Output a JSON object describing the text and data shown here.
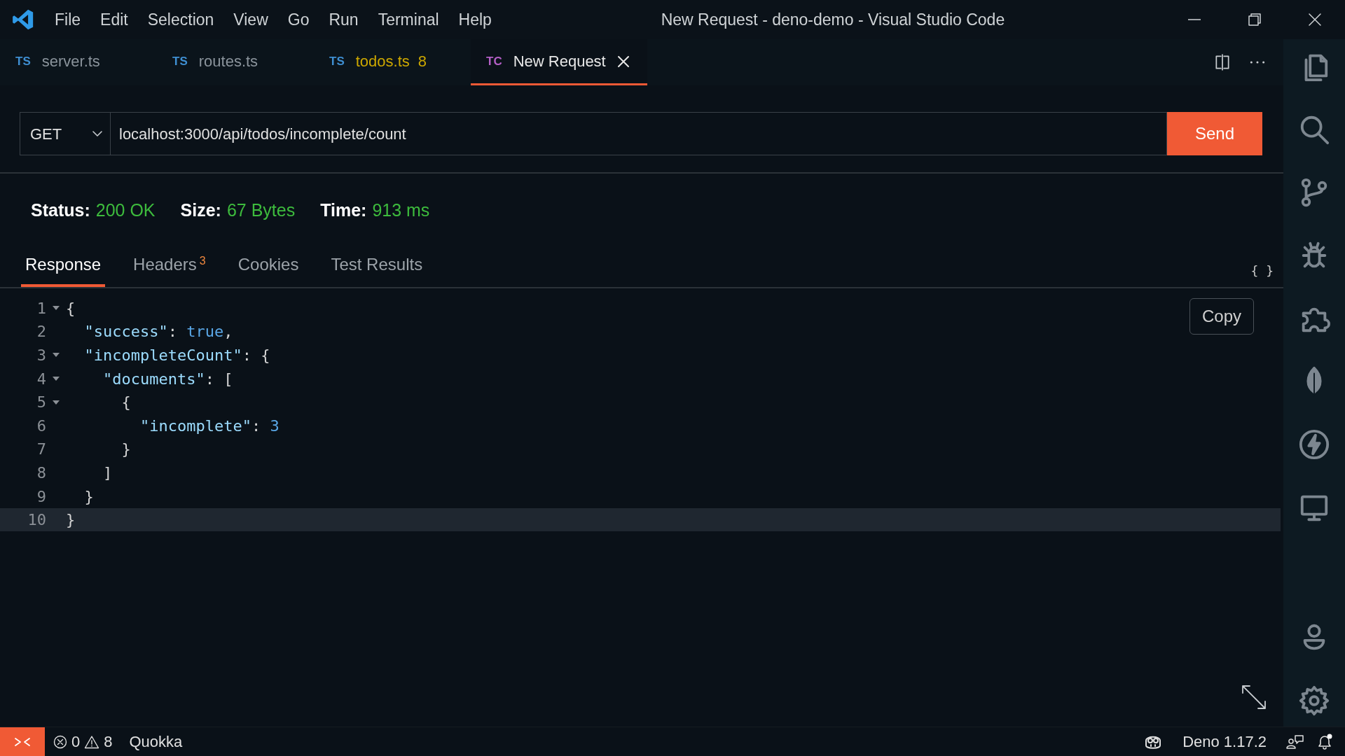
{
  "window": {
    "title": "New Request - deno-demo - Visual Studio Code"
  },
  "menu": [
    "File",
    "Edit",
    "Selection",
    "View",
    "Go",
    "Run",
    "Terminal",
    "Help"
  ],
  "editor_tabs": [
    {
      "badge": "TS",
      "color": "#3f8fd2",
      "label": "server.ts",
      "selected": false,
      "warning": false
    },
    {
      "badge": "TS",
      "color": "#3f8fd2",
      "label": "routes.ts",
      "selected": false,
      "warning": false
    },
    {
      "badge": "TS",
      "color": "#3f8fd2",
      "label": "todos.ts",
      "problems": "8",
      "selected": false,
      "warning": true
    },
    {
      "badge": "TC",
      "color": "#b45fc6",
      "label": "New Request",
      "selected": true,
      "warning": false
    }
  ],
  "request": {
    "method": "GET",
    "url": "localhost:3000/api/todos/incomplete/count",
    "send": "Send"
  },
  "response_info": [
    {
      "label": "Status:",
      "value": "200 OK"
    },
    {
      "label": "Size:",
      "value": "67 Bytes"
    },
    {
      "label": "Time:",
      "value": "913 ms"
    }
  ],
  "response_tabs": [
    {
      "label": "Response",
      "selected": true
    },
    {
      "label": "Headers",
      "badge": "3",
      "selected": false
    },
    {
      "label": "Cookies",
      "selected": false
    },
    {
      "label": "Test Results",
      "selected": false
    }
  ],
  "format_button": "{ }",
  "copy_button": "Copy",
  "code": {
    "lines": [
      {
        "number": "1",
        "foldable": true,
        "current": false,
        "tokens": [
          {
            "kind": "punct",
            "text": "{"
          }
        ]
      },
      {
        "number": "2",
        "foldable": false,
        "current": false,
        "tokens": [
          {
            "kind": "key",
            "text": "  \"success\""
          },
          {
            "kind": "punct",
            "text": ": "
          },
          {
            "kind": "literal",
            "text": "true"
          },
          {
            "kind": "punct",
            "text": ","
          }
        ]
      },
      {
        "number": "3",
        "foldable": true,
        "current": false,
        "tokens": [
          {
            "kind": "key",
            "text": "  \"incompleteCount\""
          },
          {
            "kind": "punct",
            "text": ": {"
          }
        ]
      },
      {
        "number": "4",
        "foldable": true,
        "current": false,
        "tokens": [
          {
            "kind": "key",
            "text": "    \"documents\""
          },
          {
            "kind": "punct",
            "text": ": ["
          }
        ]
      },
      {
        "number": "5",
        "foldable": true,
        "current": false,
        "tokens": [
          {
            "kind": "punct",
            "text": "      {"
          }
        ]
      },
      {
        "number": "6",
        "foldable": false,
        "current": false,
        "tokens": [
          {
            "kind": "key",
            "text": "        \"incomplete\""
          },
          {
            "kind": "punct",
            "text": ": "
          },
          {
            "kind": "literal",
            "text": "3"
          }
        ]
      },
      {
        "number": "7",
        "foldable": false,
        "current": false,
        "tokens": [
          {
            "kind": "punct",
            "text": "      }"
          }
        ]
      },
      {
        "number": "8",
        "foldable": false,
        "current": false,
        "tokens": [
          {
            "kind": "punct",
            "text": "    ]"
          }
        ]
      },
      {
        "number": "9",
        "foldable": false,
        "current": false,
        "tokens": [
          {
            "kind": "punct",
            "text": "  }"
          }
        ]
      },
      {
        "number": "10",
        "foldable": false,
        "current": true,
        "tokens": [
          {
            "kind": "punct",
            "text": "}"
          }
        ]
      }
    ]
  },
  "status_bar": {
    "errors": "0",
    "warnings": "8",
    "items": [
      "Quokka"
    ],
    "runtime": "Deno 1.17.2"
  }
}
